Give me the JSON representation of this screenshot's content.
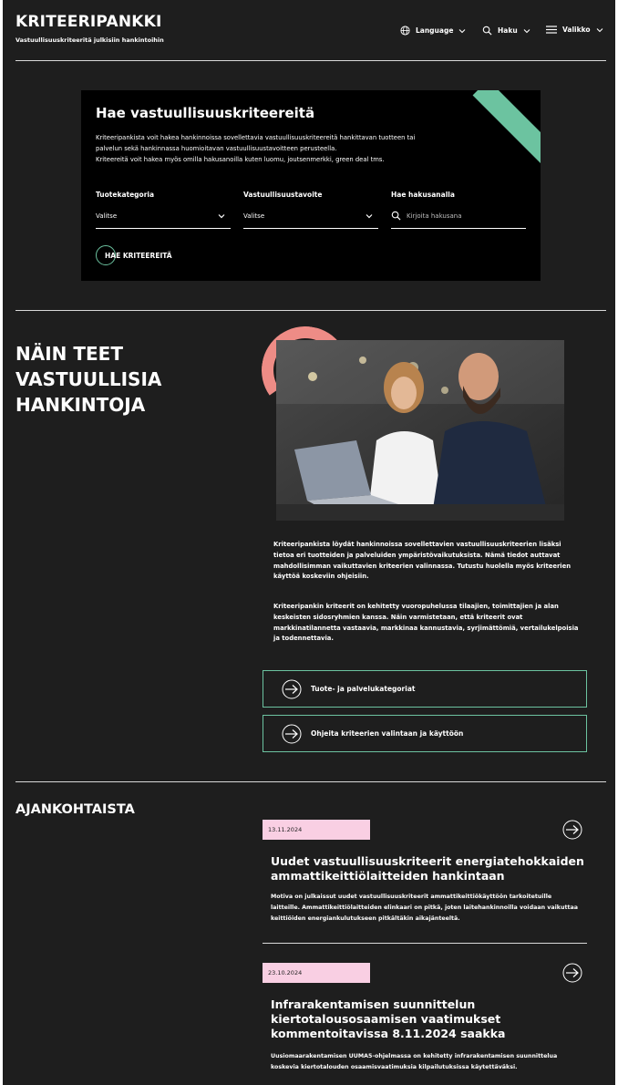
{
  "header": {
    "title": "KRITEERIPANKKI",
    "subtitle": "Vastuullisuuskriteeritä julkisiin hankintoihin",
    "nav": {
      "language": "Language",
      "search": "Haku",
      "menu": "Valikko"
    }
  },
  "search_panel": {
    "title": "Hae vastuullisuuskriteereitä",
    "text_1": "Kriteeripankista voit hakea hankinnoissa sovellettavia vastuullisuuskriteereitä hankittavan tuotteen tai palvelun sekä hankinnassa huomioitavan vastuullisuustavoitteen perusteella.",
    "text_2": "Kriteereitä voit hakea myös omilla hakusanoilla kuten luomu, joutsenmerkki, green deal tms.",
    "category_label": "Tuotekategoria",
    "category_value": "Valitse",
    "goal_label": "Vastuullisuustavoite",
    "goal_value": "Valitse",
    "keyword_label": "Hae hakusanalla",
    "keyword_placeholder": "Kirjoita hakusana",
    "search_button": "HAE KRITEEREITÄ"
  },
  "main": {
    "heading_lines": [
      "NÄIN TEET",
      "VASTUULLISIA",
      "HANKINTOJA"
    ],
    "paragraph_1": "Kriteeripankista löydät hankinnoissa sovellettavien vastuullisuuskriteerien lisäksi tietoa eri tuotteiden ja palveluiden ympäristövaikutuksista. Nämä tiedot auttavat mahdollisimman vaikuttavien kriteerien valinnassa. Tutustu huolella myös kriteerien käyttöä koskeviin ohjeisiin.",
    "paragraph_2": "Kriteeripankin kriteerit on kehitetty vuoropuhelussa tilaajien, toimittajien ja alan keskeisten sidosryhmien kanssa. Näin varmistetaan, että kriteerit ovat markkinatilannetta vastaavia, markkinaa kannustavia, syrjimättömiä, vertailukelpoisia ja todennettavia.",
    "link_1": "Tuote- ja palvelukategoriat",
    "link_2": "Ohjeita kriteerien valintaan ja käyttöön"
  },
  "news": {
    "heading": "AJANKOHTAISTA",
    "items": [
      {
        "date": "13.11.2024",
        "title": "Uudet vastuullisuuskriteerit energiatehokkaiden ammattikeittiölaitteiden hankintaan",
        "text": "Motiva on julkaissut uudet vastuullisuuskriteerit ammattikeittiökäyttöön tarkoitetuille laitteille. Ammattikeittiölaitteiden elinkaari on pitkä, joten laitehankinnoilla voidaan vaikuttaa keittiöiden energiankulutukseen pitkältäkin aikajänteeltä."
      },
      {
        "date": "23.10.2024",
        "title": "Infrarakentamisen suunnittelun kiertotalousosaamisen vaatimukset kommentoitavissa 8.11.2024 saakka",
        "text": "Uusiomaarakentamisen UUMA5-ohjelmassa on kehitetty infrarakentamisen suunnittelua koskevia kiertotalouden osaamisvaatimuksia kilpailutuksissa käytettäväksi."
      }
    ]
  },
  "colors": {
    "background": "#1e1e1e",
    "accent_green": "#6cc3a0",
    "accent_coral": "#ee8c86",
    "date_pink": "#f9cfe3"
  },
  "icons": [
    "globe-icon",
    "search-icon",
    "menu-icon",
    "chevron-down-icon",
    "arrow-right-icon"
  ]
}
